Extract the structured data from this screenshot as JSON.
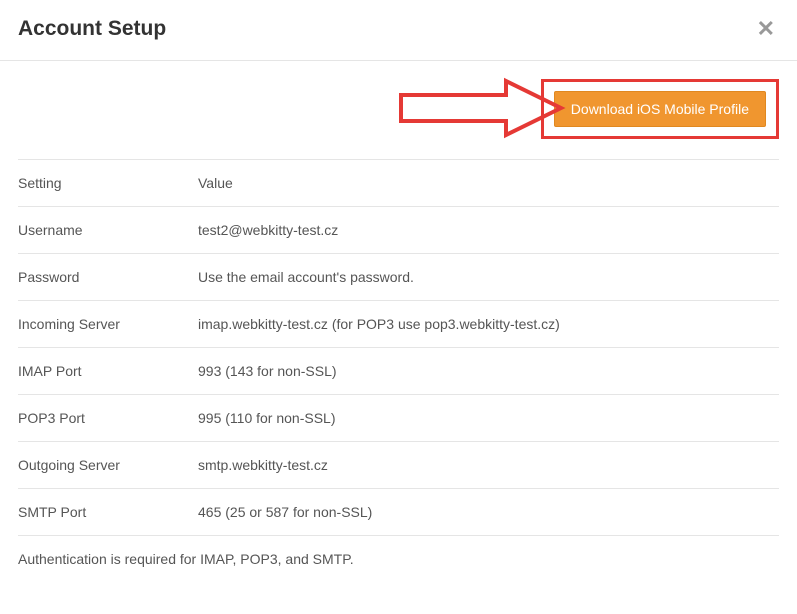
{
  "header": {
    "title": "Account Setup"
  },
  "action": {
    "download_label": "Download iOS Mobile Profile"
  },
  "table": {
    "header_setting": "Setting",
    "header_value": "Value",
    "rows": [
      {
        "label": "Username",
        "value": "test2@webkitty-test.cz"
      },
      {
        "label": "Password",
        "value": "Use the email account's password."
      },
      {
        "label": "Incoming Server",
        "value": "imap.webkitty-test.cz (for POP3 use pop3.webkitty-test.cz)"
      },
      {
        "label": "IMAP Port",
        "value": "993 (143 for non-SSL)"
      },
      {
        "label": "POP3 Port",
        "value": "995 (110 for non-SSL)"
      },
      {
        "label": "Outgoing Server",
        "value": "smtp.webkitty-test.cz"
      },
      {
        "label": "SMTP Port",
        "value": "465 (25 or 587 for non-SSL)"
      }
    ]
  },
  "note": "Authentication is required for IMAP, POP3, and SMTP.",
  "annotation": {
    "arrow_color": "#e53935"
  }
}
